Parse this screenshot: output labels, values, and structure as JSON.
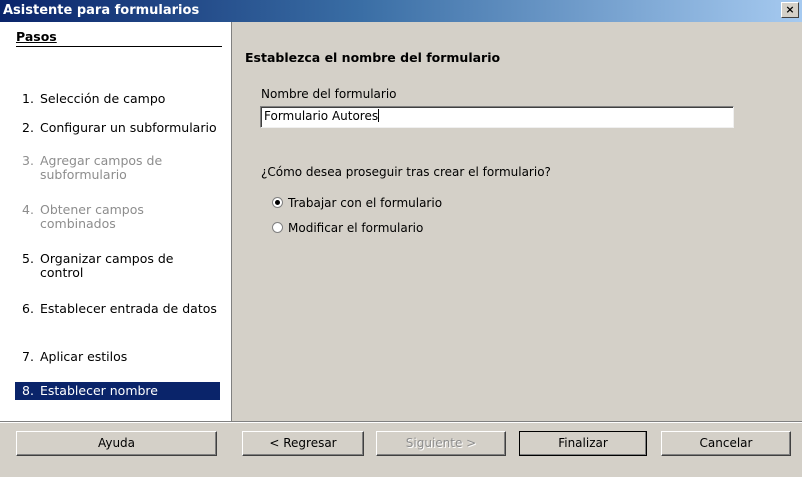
{
  "window": {
    "title": "Asistente para formularios",
    "close_label": "×"
  },
  "sidebar": {
    "title": "Pasos",
    "steps": [
      {
        "num": "1.",
        "label": "Selección de campo",
        "state": "enabled"
      },
      {
        "num": "2.",
        "label": "Configurar un subformulario",
        "state": "enabled"
      },
      {
        "num": "3.",
        "label": "Agregar campos de subformulario",
        "state": "disabled"
      },
      {
        "num": "4.",
        "label": "Obtener campos combinados",
        "state": "disabled"
      },
      {
        "num": "5.",
        "label": "Organizar campos de control",
        "state": "enabled"
      },
      {
        "num": "6.",
        "label": "Establecer entrada de datos",
        "state": "enabled"
      },
      {
        "num": "7.",
        "label": "Aplicar estilos",
        "state": "enabled"
      },
      {
        "num": "8.",
        "label": "Establecer nombre",
        "state": "active"
      }
    ]
  },
  "main": {
    "title": "Establezca el nombre del formulario",
    "name_label": "Nombre del formulario",
    "name_value": "Formulario Autores",
    "question": "¿Cómo desea proseguir tras crear el formulario?",
    "options": [
      {
        "label": "Trabajar con el formulario",
        "checked": true
      },
      {
        "label": "Modificar el formulario",
        "checked": false
      }
    ]
  },
  "buttons": {
    "help": "Ayuda",
    "back": "< Regresar",
    "next": "Siguiente >",
    "finish": "Finalizar",
    "cancel": "Cancelar"
  },
  "colors": {
    "selection": "#0a246a",
    "dialog_bg": "#d4d0c8",
    "disabled_text": "#8d8d8d"
  }
}
